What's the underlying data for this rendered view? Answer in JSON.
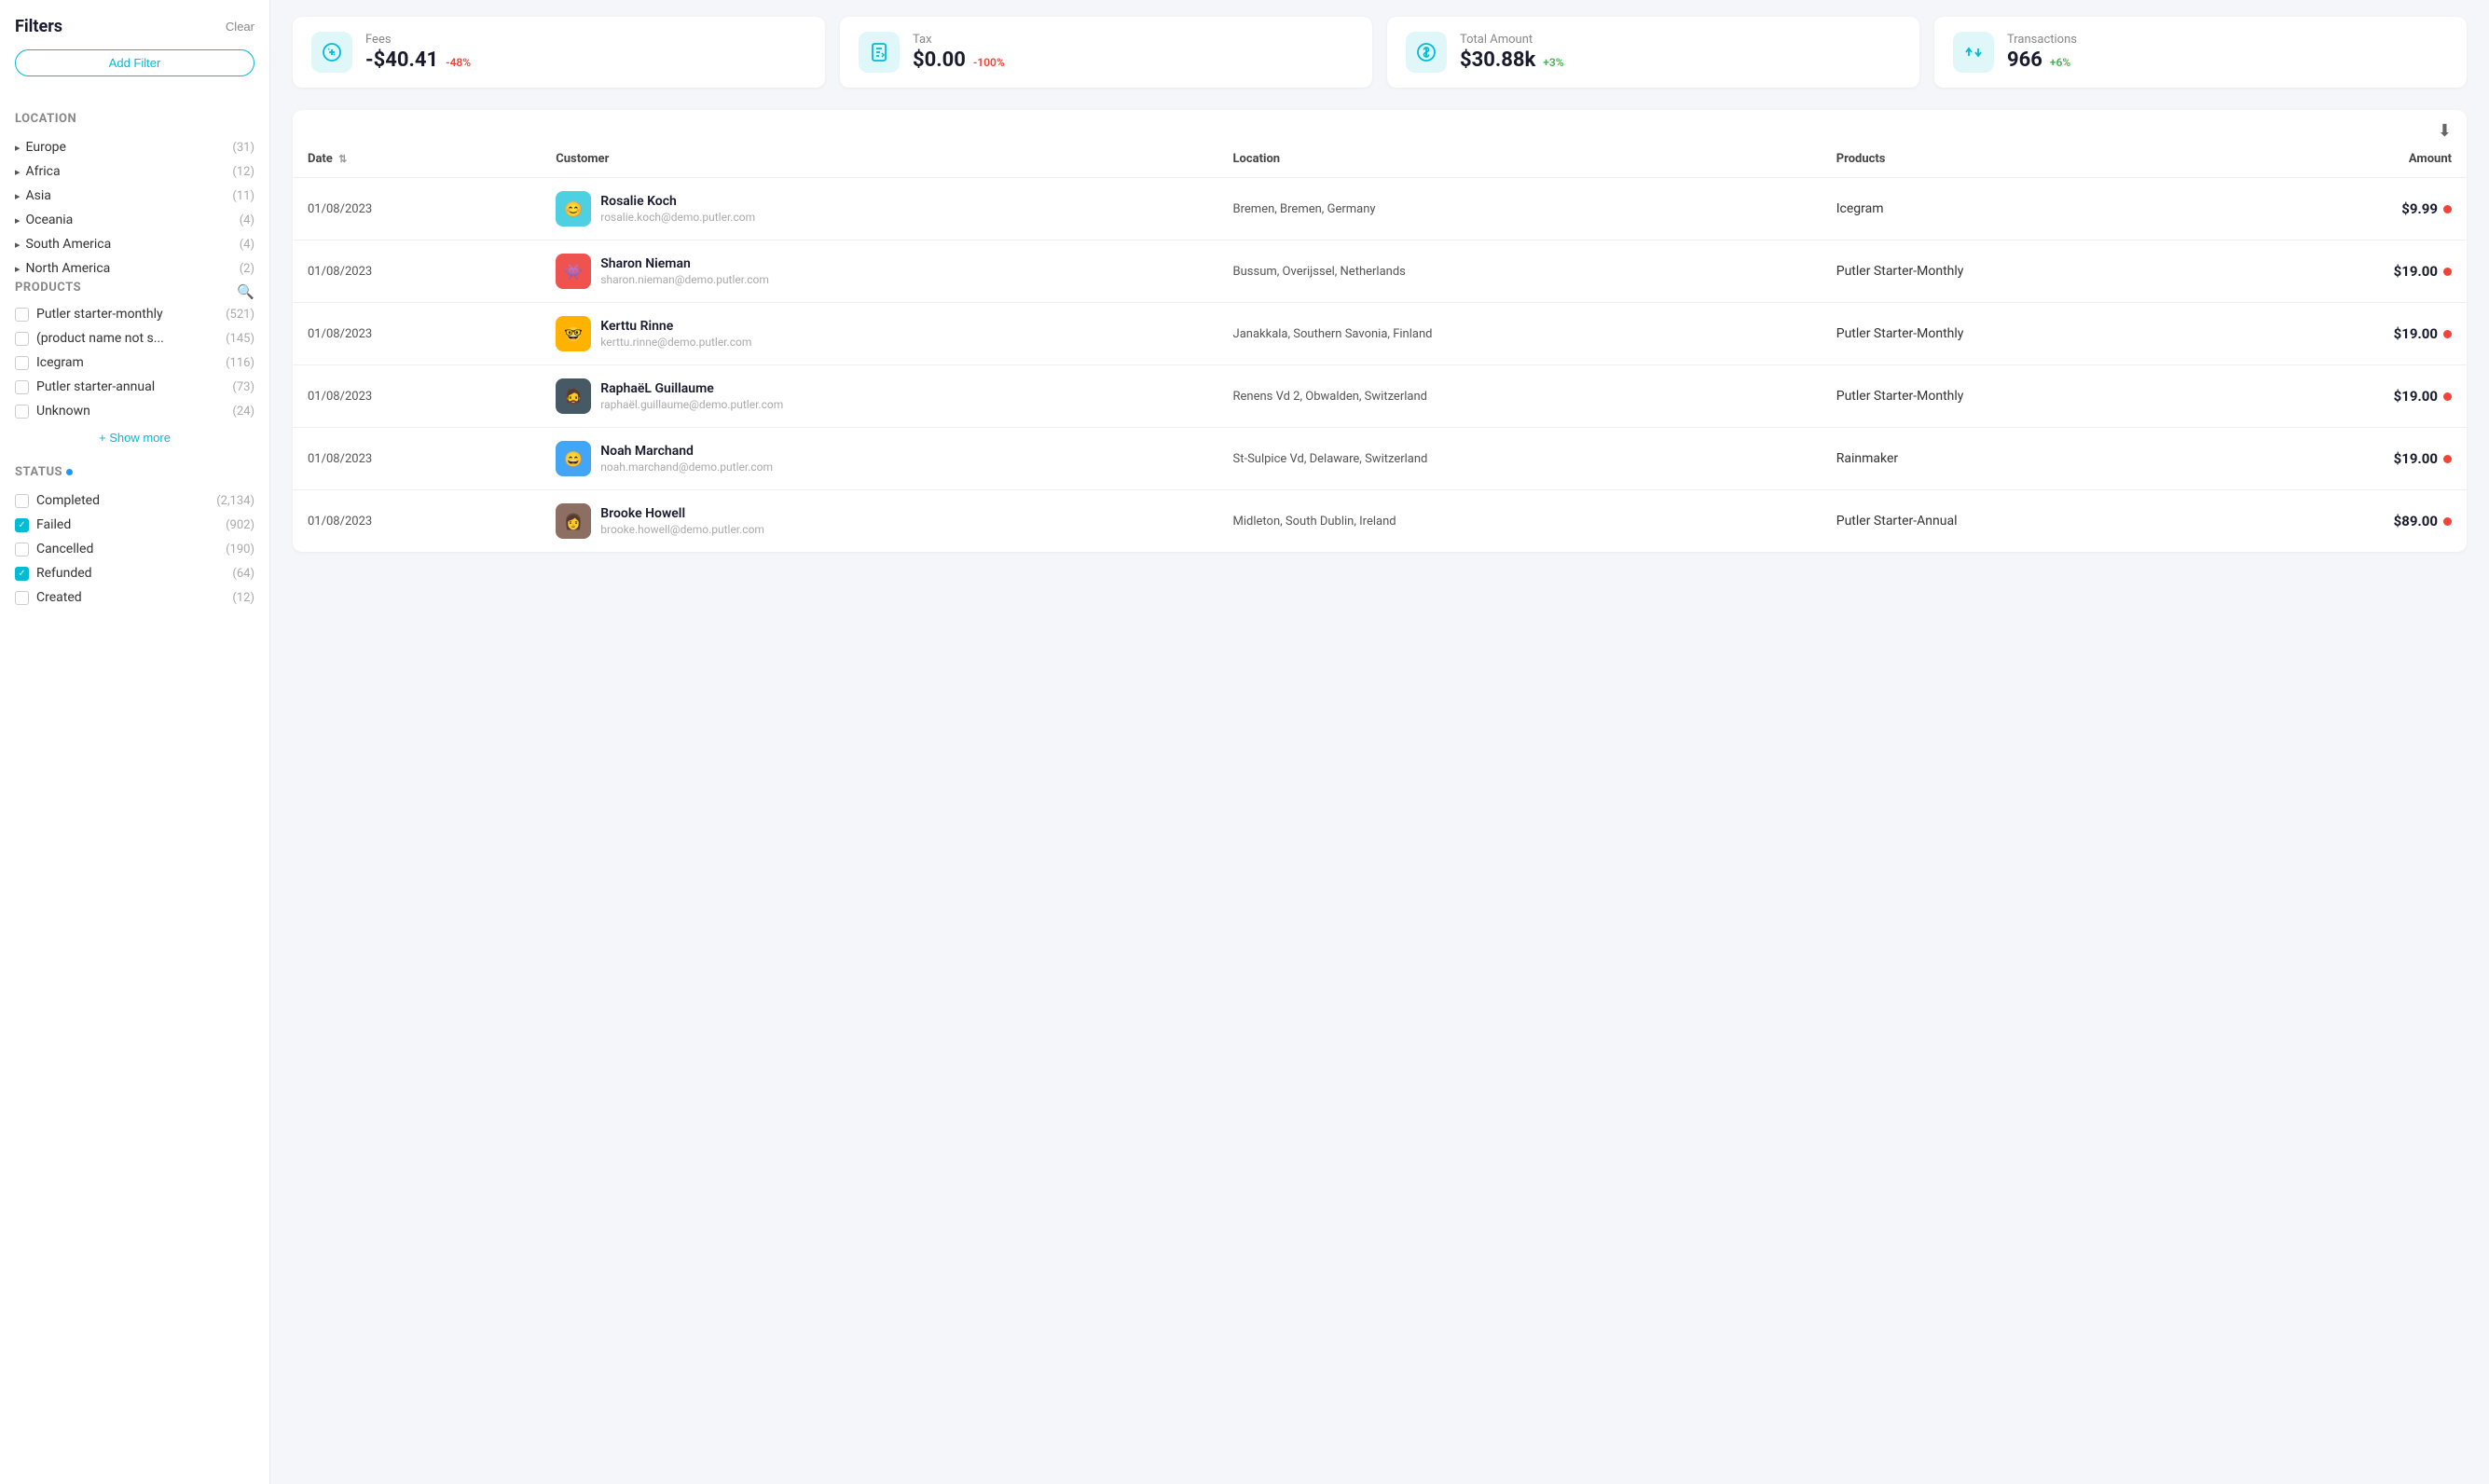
{
  "sidebar": {
    "filters_title": "Filters",
    "clear_label": "Clear",
    "add_filter_label": "Add Filter",
    "location_section": "Location",
    "location_items": [
      {
        "name": "Europe",
        "count": "(31)"
      },
      {
        "name": "Africa",
        "count": "(12)"
      },
      {
        "name": "Asia",
        "count": "(11)"
      },
      {
        "name": "Oceania",
        "count": "(4)"
      },
      {
        "name": "South America",
        "count": "(4)"
      },
      {
        "name": "North America",
        "count": "(2)"
      }
    ],
    "products_section": "Products",
    "products": [
      {
        "name": "Putler starter-monthly",
        "count": "(521)",
        "checked": false
      },
      {
        "name": "(product name not s...",
        "count": "(145)",
        "checked": false
      },
      {
        "name": "Icegram",
        "count": "(116)",
        "checked": false
      },
      {
        "name": "Putler starter-annual",
        "count": "(73)",
        "checked": false
      },
      {
        "name": "Unknown",
        "count": "(24)",
        "checked": false
      }
    ],
    "show_more_label": "+ Show more",
    "status_section": "Status",
    "status_items": [
      {
        "name": "Completed",
        "count": "(2,134)",
        "checked": false
      },
      {
        "name": "Failed",
        "count": "(902)",
        "checked": true
      },
      {
        "name": "Cancelled",
        "count": "(190)",
        "checked": false
      },
      {
        "name": "Refunded",
        "count": "(64)",
        "checked": true
      },
      {
        "name": "Created",
        "count": "(12)",
        "checked": false
      }
    ]
  },
  "metrics": [
    {
      "label": "Fees",
      "value": "-$40.41",
      "change": "-48%",
      "change_type": "negative"
    },
    {
      "label": "Tax",
      "value": "$0.00",
      "change": "-100%",
      "change_type": "negative"
    },
    {
      "label": "Total Amount",
      "value": "$30.88k",
      "change": "+3%",
      "change_type": "positive"
    },
    {
      "label": "Transactions",
      "value": "966",
      "change": "+6%",
      "change_type": "positive"
    }
  ],
  "table": {
    "columns": [
      "Date",
      "Customer",
      "Location",
      "Products",
      "Amount"
    ],
    "rows": [
      {
        "date": "01/08/2023",
        "customer_name": "Rosalie Koch",
        "customer_email": "rosalie.koch@demo.putler.com",
        "location": "Bremen, Bremen, Germany",
        "product": "Icegram",
        "amount": "$9.99",
        "avatar_color": "teal",
        "avatar_emoji": "🟦"
      },
      {
        "date": "01/08/2023",
        "customer_name": "Sharon Nieman",
        "customer_email": "sharon.nieman@demo.putler.com",
        "location": "Bussum, Overijssel, Netherlands",
        "product": "Putler Starter-Monthly",
        "amount": "$19.00",
        "avatar_color": "red",
        "avatar_emoji": "👾"
      },
      {
        "date": "01/08/2023",
        "customer_name": "Kerttu Rinne",
        "customer_email": "kerttu.rinne@demo.putler.com",
        "location": "Janakkala, Southern Savonia, Finland",
        "product": "Putler Starter-Monthly",
        "amount": "$19.00",
        "avatar_color": "yellow",
        "avatar_emoji": "🤓"
      },
      {
        "date": "01/08/2023",
        "customer_name": "RaphaëL Guillaume",
        "customer_email": "raphaël.guillaume@demo.putler.com",
        "location": "Renens Vd 2, Obwalden, Switzerland",
        "product": "Putler Starter-Monthly",
        "amount": "$19.00",
        "avatar_color": "dark",
        "avatar_emoji": "🧑"
      },
      {
        "date": "01/08/2023",
        "customer_name": "Noah Marchand",
        "customer_email": "noah.marchand@demo.putler.com",
        "location": "St-Sulpice Vd, Delaware, Switzerland",
        "product": "Rainmaker",
        "amount": "$19.00",
        "avatar_color": "blue",
        "avatar_emoji": "😊"
      },
      {
        "date": "01/08/2023",
        "customer_name": "Brooke Howell",
        "customer_email": "brooke.howell@demo.putler.com",
        "location": "Midleton, South Dublin, Ireland",
        "product": "Putler Starter-Annual",
        "amount": "$89.00",
        "avatar_color": "brown",
        "avatar_emoji": "👩"
      }
    ]
  }
}
